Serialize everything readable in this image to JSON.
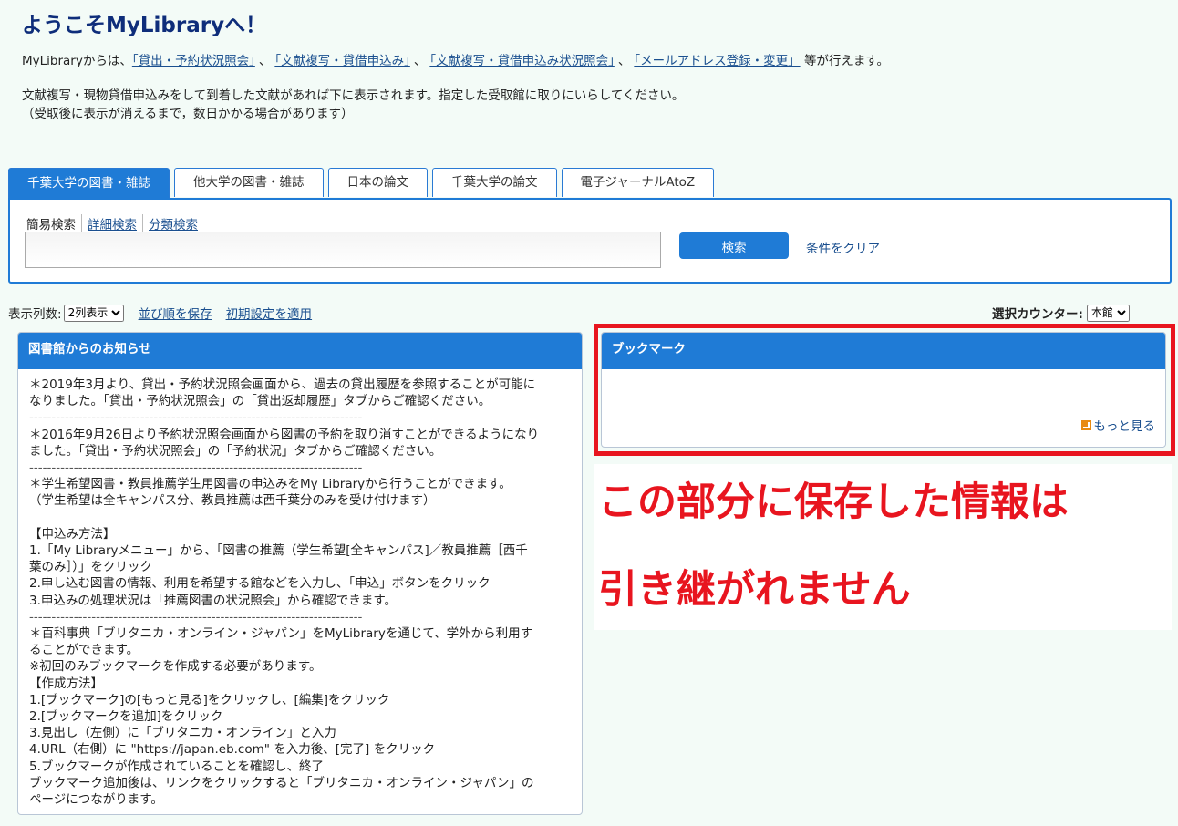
{
  "header": {
    "title": "ようこそMyLibraryへ！",
    "intro_prefix": "MyLibraryからは、",
    "intro_links": [
      "「貸出・予約状況照会」",
      "「文献複写・貸借申込み」",
      "「文献複写・貸借申込み状況照会」",
      "「メールアドレス登録・変更」"
    ],
    "intro_separator": "、",
    "intro_suffix": "等が行えます。",
    "notice_line1": "文献複写・現物貸借申込みをして到着した文献があれば下に表示されます。指定した受取館に取りにいらしてください。",
    "notice_line2": "（受取後に表示が消えるまで，数日かかる場合があります）"
  },
  "tabs": [
    "千葉大学の図書・雑誌",
    "他大学の図書・雑誌",
    "日本の論文",
    "千葉大学の論文",
    "電子ジャーナルAtoZ"
  ],
  "search": {
    "mode_simple": "簡易検索",
    "mode_detail": "詳細検索",
    "mode_category": "分類検索",
    "input_value": "",
    "button_label": "検索",
    "clear_label": "条件をクリア"
  },
  "view": {
    "columns_label": "表示列数:",
    "columns_value": "2列表示",
    "save_order": "並び順を保存",
    "apply_default": "初期設定を適用",
    "counter_label": "選択カウンター:",
    "counter_value": "本館"
  },
  "news": {
    "title": "図書館からのお知らせ",
    "lines": [
      "＊2019年3月より、貸出・予約状況照会画面から、過去の貸出履歴を参照することが可能に",
      "なりました。「貸出・予約状況照会」の「貸出返却履歴」タブからご確認ください。",
      "---------------------------------------------------------------------------",
      "＊2016年9月26日より予約状況照会画面から図書の予約を取り消すことができるようになり",
      "ました。「貸出・予約状況照会」の「予約状況」タブからご確認ください。",
      "---------------------------------------------------------------------------",
      "＊学生希望図書・教員推薦学生用図書の申込みをMy Libraryから行うことができます。",
      "（学生希望は全キャンパス分、教員推薦は西千葉分のみを受け付けます）",
      " ",
      "【申込み方法】",
      "1.「My Libraryメニュー」から、「図書の推薦（学生希望[全キャンパス]／教員推薦［西千",
      "葉のみ］）」をクリック",
      "2.申し込む図書の情報、利用を希望する館などを入力し、「申込」ボタンをクリック",
      "3.申込みの処理状況は「推薦図書の状況照会」から確認できます。",
      "---------------------------------------------------------------------------",
      "＊百科事典「ブリタニカ・オンライン・ジャパン」をMyLibraryを通じて、学外から利用す",
      "ることができます。",
      "※初回のみブックマークを作成する必要があります。",
      "【作成方法】",
      "1.[ブックマーク]の[もっと見る]をクリックし、[編集]をクリック",
      "2.[ブックマークを追加]をクリック",
      "3.見出し（左側）に「ブリタニカ・オンライン」と入力",
      "4.URL（右側）に \"https://japan.eb.com\" を入力後、[完了] をクリック",
      "5.ブックマークが作成されていることを確認し、終了",
      "ブックマーク追加後は、リンクをクリックすると「ブリタニカ・オンライン・ジャパン」の",
      "ページにつながります。"
    ]
  },
  "bookmark": {
    "title": "ブックマーク",
    "more_label": "もっと見る"
  },
  "annotation": {
    "line1": "この部分に保存した情報は",
    "line2": "引き継がれません"
  }
}
